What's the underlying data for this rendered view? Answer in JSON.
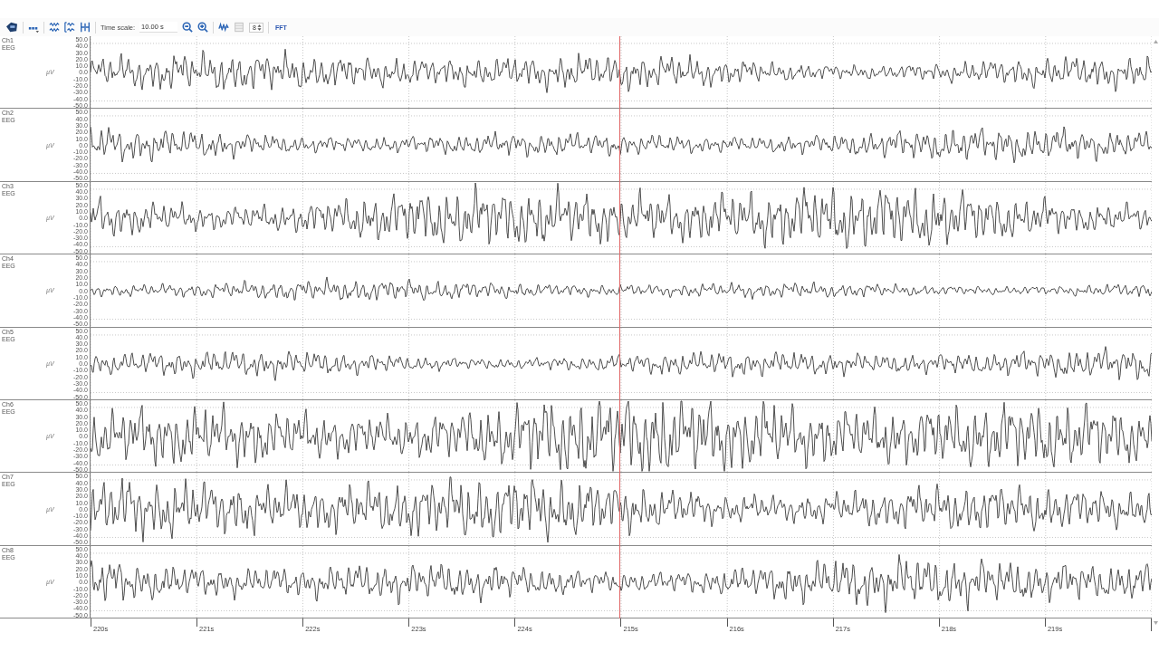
{
  "toolbar": {
    "time_scale_label": "Time scale:",
    "time_scale_value": "10.00 s",
    "channel_count": "8",
    "fft_label": "FFT"
  },
  "channels": [
    {
      "name": "Ch1",
      "type": "EEG",
      "unit": "µV",
      "y_ticks": [
        "50.0",
        "40.0",
        "30.0",
        "20.0",
        "10.0",
        "0.0",
        "-10.0",
        "-20.0",
        "-30.0",
        "-40.0",
        "-50.0"
      ]
    },
    {
      "name": "Ch2",
      "type": "EEG",
      "unit": "µV",
      "y_ticks": [
        "50.0",
        "40.0",
        "30.0",
        "20.0",
        "10.0",
        "0.0",
        "-10.0",
        "-20.0",
        "-30.0",
        "-40.0",
        "-50.0"
      ]
    },
    {
      "name": "Ch3",
      "type": "EEG",
      "unit": "µV",
      "y_ticks": [
        "50.0",
        "40.0",
        "30.0",
        "20.0",
        "10.0",
        "0.0",
        "-10.0",
        "-20.0",
        "-30.0",
        "-40.0",
        "-50.0"
      ]
    },
    {
      "name": "Ch4",
      "type": "EEG",
      "unit": "µV",
      "y_ticks": [
        "50.0",
        "40.0",
        "30.0",
        "20.0",
        "10.0",
        "0.0",
        "-10.0",
        "-20.0",
        "-30.0",
        "-40.0",
        "-50.0"
      ]
    },
    {
      "name": "Ch5",
      "type": "EEG",
      "unit": "µV",
      "y_ticks": [
        "50.0",
        "40.0",
        "30.0",
        "20.0",
        "10.0",
        "0.0",
        "-10.0",
        "-20.0",
        "-30.0",
        "-40.0",
        "-50.0"
      ]
    },
    {
      "name": "Ch6",
      "type": "EEG",
      "unit": "µV",
      "y_ticks": [
        "50.0",
        "40.0",
        "30.0",
        "20.0",
        "10.0",
        "0.0",
        "-10.0",
        "-20.0",
        "-30.0",
        "-40.0",
        "-50.0"
      ]
    },
    {
      "name": "Ch7",
      "type": "EEG",
      "unit": "µV",
      "y_ticks": [
        "50.0",
        "40.0",
        "30.0",
        "20.0",
        "10.0",
        "0.0",
        "-10.0",
        "-20.0",
        "-30.0",
        "-40.0",
        "-50.0"
      ]
    },
    {
      "name": "Ch8",
      "type": "EEG",
      "unit": "µV",
      "y_ticks": [
        "50.0",
        "40.0",
        "30.0",
        "20.0",
        "10.0",
        "0.0",
        "-10.0",
        "-20.0",
        "-30.0",
        "-40.0",
        "-50.0"
      ]
    }
  ],
  "time_axis": {
    "labels": [
      "220s",
      "221s",
      "222s",
      "223s",
      "224s",
      "215s",
      "216s",
      "217s",
      "218s",
      "219s"
    ]
  }
}
